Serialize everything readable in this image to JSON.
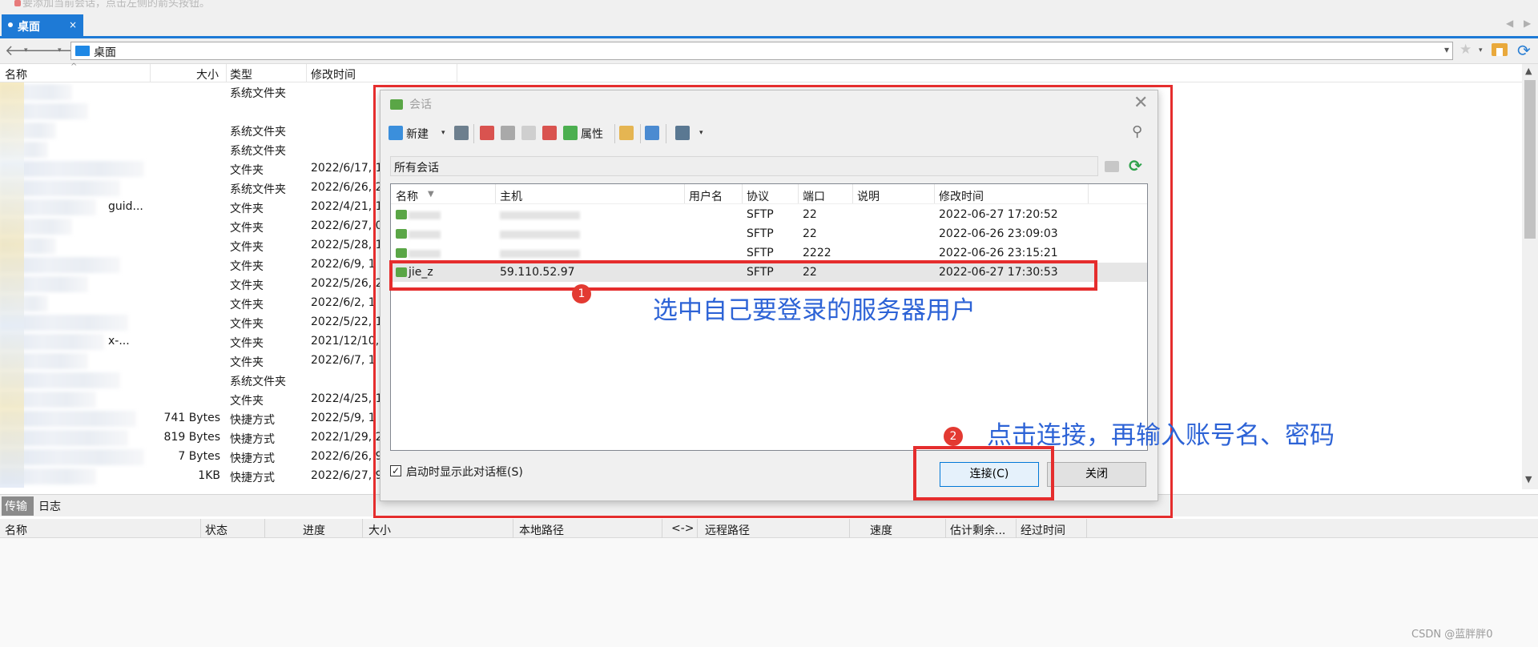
{
  "top_hint": "要添加当前会话，点击左侧的箭头按钮。",
  "tab": {
    "label": "桌面",
    "close": "×"
  },
  "tab_nav": {
    "prev": "◀",
    "next": "▶"
  },
  "address": {
    "path": "桌面",
    "back": "🡐",
    "forward": "🡒",
    "dropdown": "▾",
    "star": "★",
    "refresh": "⟳"
  },
  "file_columns": {
    "name": "名称",
    "size": "大小",
    "type": "类型",
    "modified": "修改时间",
    "sort_caret": "^"
  },
  "files": [
    {
      "size": "",
      "type": "系统文件夹",
      "modified": "",
      "stub": ""
    },
    {
      "size": "",
      "type": "",
      "modified": "",
      "stub": ""
    },
    {
      "size": "",
      "type": "系统文件夹",
      "modified": "",
      "stub": ""
    },
    {
      "size": "",
      "type": "系统文件夹",
      "modified": "",
      "stub": ""
    },
    {
      "size": "",
      "type": "文件夹",
      "modified": "2022/6/17, 1",
      "stub": ""
    },
    {
      "size": "",
      "type": "系统文件夹",
      "modified": "2022/6/26, 2",
      "stub": ""
    },
    {
      "size": "",
      "type": "文件夹",
      "modified": "2022/4/21, 1",
      "stub": "guid..."
    },
    {
      "size": "",
      "type": "文件夹",
      "modified": "2022/6/27, 0",
      "stub": ""
    },
    {
      "size": "",
      "type": "文件夹",
      "modified": "2022/5/28, 1",
      "stub": ""
    },
    {
      "size": "",
      "type": "文件夹",
      "modified": "2022/6/9, 1",
      "stub": ""
    },
    {
      "size": "",
      "type": "文件夹",
      "modified": "2022/5/26, 2",
      "stub": ""
    },
    {
      "size": "",
      "type": "文件夹",
      "modified": "2022/6/2, 1",
      "stub": ""
    },
    {
      "size": "",
      "type": "文件夹",
      "modified": "2022/5/22, 1",
      "stub": ""
    },
    {
      "size": "",
      "type": "文件夹",
      "modified": "2021/12/10,",
      "stub": "x-..."
    },
    {
      "size": "",
      "type": "文件夹",
      "modified": "2022/6/7, 1",
      "stub": ""
    },
    {
      "size": "",
      "type": "系统文件夹",
      "modified": "",
      "stub": ""
    },
    {
      "size": "",
      "type": "文件夹",
      "modified": "2022/4/25, 1",
      "stub": ""
    },
    {
      "size": "741 Bytes",
      "type": "快捷方式",
      "modified": "2022/5/9, 1",
      "stub": ""
    },
    {
      "size": "819 Bytes",
      "type": "快捷方式",
      "modified": "2022/1/29, 2",
      "stub": ""
    },
    {
      "size": "7 Bytes",
      "type": "快捷方式",
      "modified": "2022/6/26, 9",
      "stub": ""
    },
    {
      "size": "1KB",
      "type": "快捷方式",
      "modified": "2022/6/27, 9",
      "stub": ""
    }
  ],
  "transfer_tabs": {
    "transfer": "传输",
    "log": "日志"
  },
  "transfer_columns": {
    "name": "名称",
    "status": "状态",
    "progress": "进度",
    "size": "大小",
    "local_path": "本地路径",
    "direction": "<->",
    "remote_path": "远程路径",
    "speed": "速度",
    "eta": "估计剩余...",
    "elapsed": "经过时间"
  },
  "dialog": {
    "title": "会话",
    "close": "✕",
    "toolbar": {
      "new": "新建",
      "properties": "属性",
      "drop": "▾"
    },
    "folder": "所有会话",
    "columns": {
      "name": "名称",
      "host": "主机",
      "user": "用户名",
      "protocol": "协议",
      "port": "端口",
      "desc": "说明",
      "modified": "修改时间"
    },
    "sessions": [
      {
        "name": "",
        "host": "",
        "protocol": "SFTP",
        "port": "22",
        "modified": "2022-06-27 17:20:52",
        "selected": false
      },
      {
        "name": "",
        "host": "",
        "protocol": "SFTP",
        "port": "22",
        "modified": "2022-06-26 23:09:03",
        "selected": false
      },
      {
        "name": "",
        "host": "",
        "protocol": "SFTP",
        "port": "2222",
        "modified": "2022-06-26 23:15:21",
        "selected": false
      },
      {
        "name": "jie_z",
        "host": "59.110.52.97",
        "protocol": "SFTP",
        "port": "22",
        "modified": "2022-06-27 17:30:53",
        "selected": true
      }
    ],
    "startup_checkbox": {
      "label": "启动时显示此对话框(S)",
      "checked": "✓"
    },
    "connect_button": "连接(C)",
    "close_button": "关闭"
  },
  "annotations": {
    "badge_1": "1",
    "badge_2": "2",
    "note_1": "选中自己要登录的服务器用户",
    "note_2": "点击连接，再输入账号名、密码",
    "color": "#2d63d6",
    "highlight_color": "#e52d2d"
  },
  "watermark": "CSDN @蓝胖胖0"
}
